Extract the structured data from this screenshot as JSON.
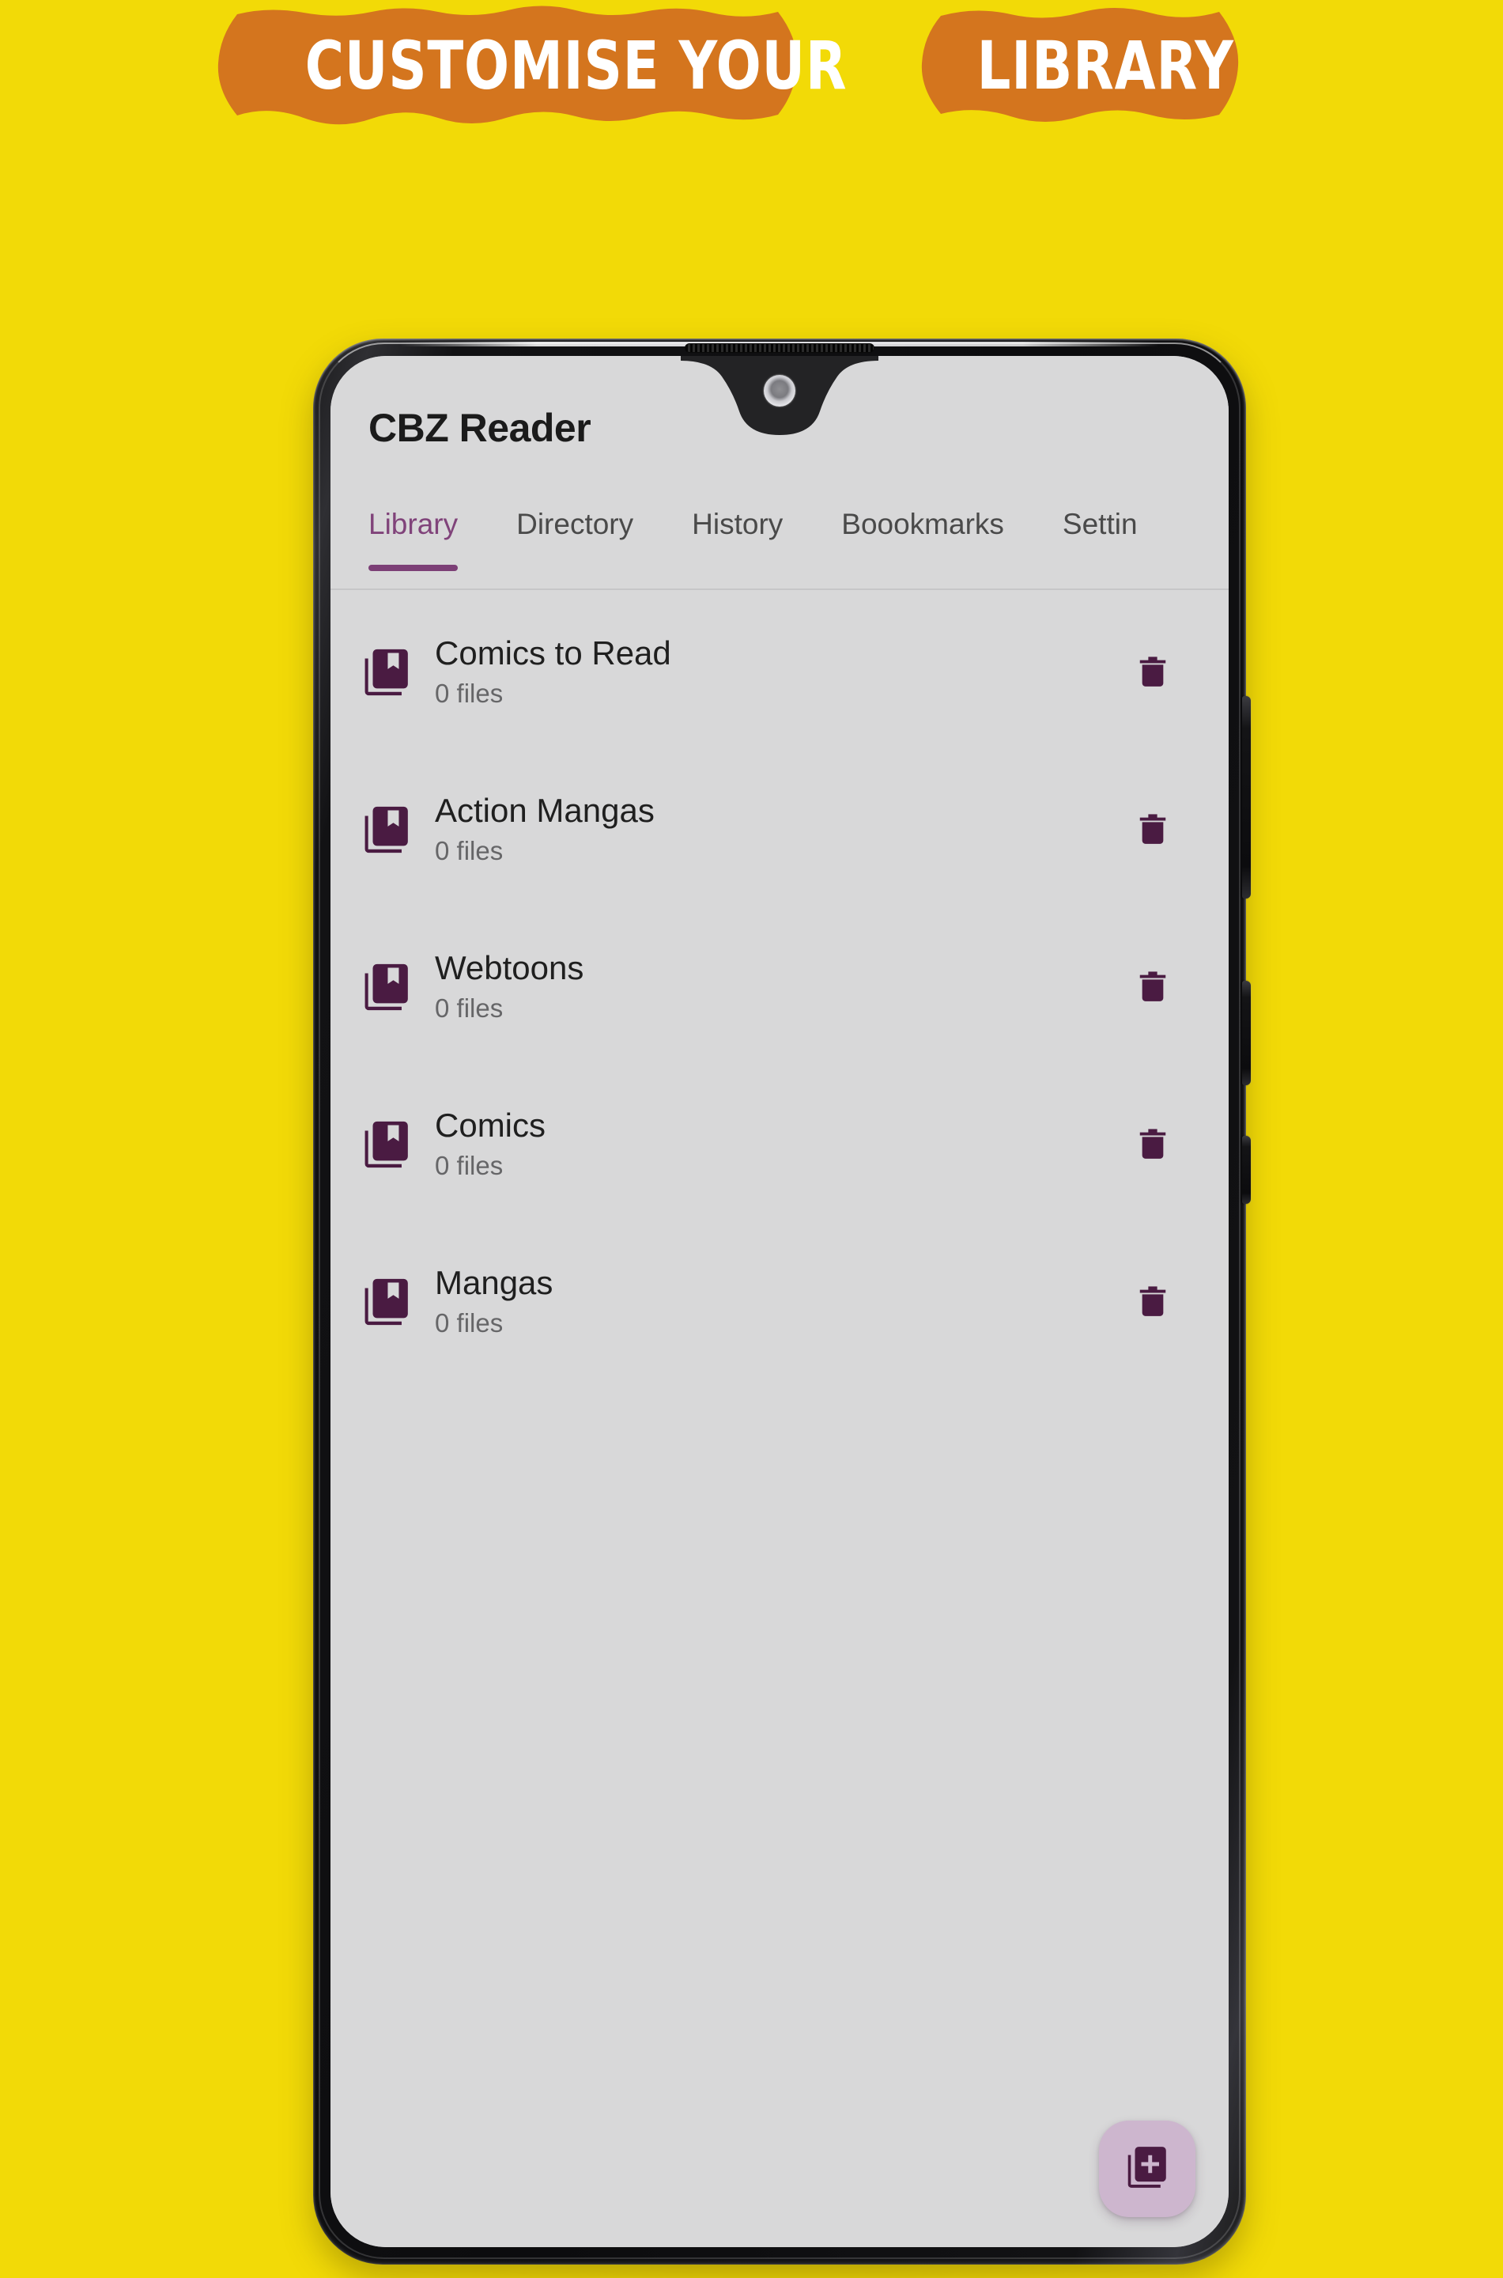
{
  "promo_banner": {
    "words": [
      "CUSTOMISE YOUR",
      "LIBRARY"
    ],
    "full_text": "CUSTOMISE YOUR LIBRARY",
    "text_color": "#FFFFFF",
    "highlight_color": "#D4751E",
    "page_background": "#F2DA07"
  },
  "device": {
    "frame_color": "#0c0c0e",
    "screen_background": "#D8D8D9",
    "notch_style": "waterdrop",
    "front_camera": "front-camera",
    "earpiece": "earpiece-speaker",
    "side_buttons": [
      "volume",
      "power",
      "extra"
    ]
  },
  "app": {
    "title": "CBZ Reader",
    "accent_color": "#7C3F76",
    "icon_color": "#4A1B42",
    "tabs": [
      {
        "label": "Library",
        "active": true
      },
      {
        "label": "Directory",
        "active": false
      },
      {
        "label": "History",
        "active": false
      },
      {
        "label": "Boookmarks",
        "active": false
      },
      {
        "label": "Settin",
        "active": false
      }
    ],
    "library_items": [
      {
        "name": "Comics to Read",
        "files": "0 files"
      },
      {
        "name": "Action Mangas",
        "files": "0 files"
      },
      {
        "name": "Webtoons",
        "files": "0 files"
      },
      {
        "name": "Comics",
        "files": "0 files"
      },
      {
        "name": "Mangas",
        "files": "0 files"
      }
    ],
    "row_icon": "collections-bookmark-icon",
    "row_action_icon": "delete-trash-icon",
    "fab": {
      "icon": "library-add-icon",
      "background": "#CDB6CE",
      "icon_color": "#4A1B42"
    }
  }
}
